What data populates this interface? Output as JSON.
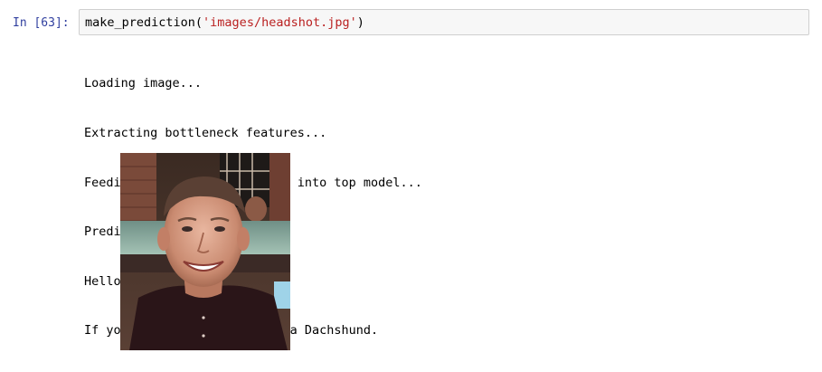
{
  "cell": {
    "prompt": "In [63]:",
    "code": {
      "function": "make_prediction(",
      "argument": "'images/headshot.jpg'",
      "close": ")"
    },
    "output_lines": [
      "Loading image...",
      "Extracting bottleneck features...",
      "Feeding bottlenneck features into top model...",
      "Predicting breed...",
      "Hello human!",
      "If you were a dog, you'd be a Dachshund."
    ],
    "image": {
      "alt": "headshot photo"
    }
  },
  "colors": {
    "prompt": "#303f9f",
    "string": "#ba2121",
    "input_bg": "#f7f7f7",
    "input_border": "#cfcfcf"
  }
}
